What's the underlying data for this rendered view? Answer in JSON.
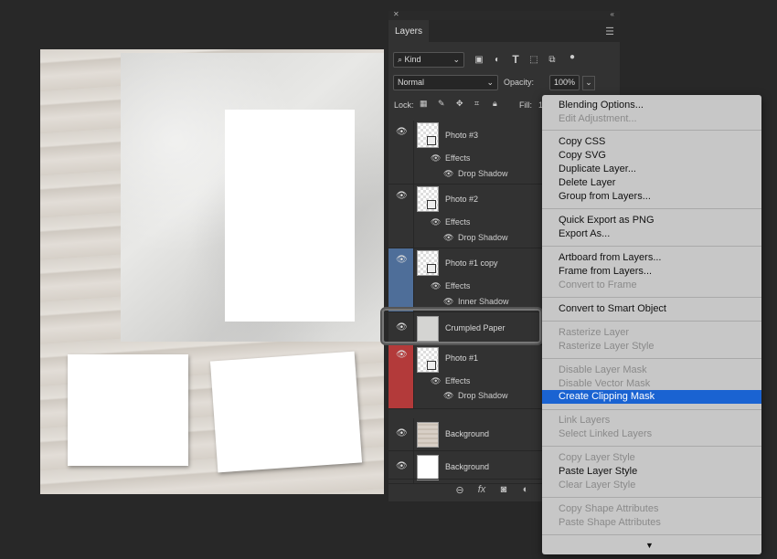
{
  "layers_panel": {
    "collapse_icon": "«",
    "close_icon": "✕",
    "tab": "Layers",
    "filter_kind": "Kind",
    "blend_mode": "Normal",
    "opacity_label": "Opacity:",
    "opacity_value": "100%",
    "lock_label": "Lock:",
    "fill_label": "Fill:",
    "fill_value": "1",
    "layers": [
      {
        "name": "Photo #3",
        "effects_label": "Effects",
        "effect": "Drop Shadow"
      },
      {
        "name": "Photo #2",
        "effects_label": "Effects",
        "effect": "Drop Shadow"
      },
      {
        "name": "Photo #1  copy",
        "effects_label": "Effects",
        "effect": "Inner Shadow"
      },
      {
        "name": "Crumpled Paper"
      },
      {
        "name": "Photo #1",
        "effects_label": "Effects",
        "effect": "Drop Shadow"
      },
      {
        "name": "Background"
      },
      {
        "name": "Background"
      }
    ],
    "bottom_icons": [
      "link-icon",
      "fx-icon",
      "mask-icon",
      "adjustment-icon"
    ],
    "colors": {
      "selected_row": "#4e6e99",
      "red_row": "#b33a3a",
      "panel_bg": "#323232"
    }
  },
  "context_menu": {
    "items": [
      {
        "label": "Blending Options...",
        "state": "enabled"
      },
      {
        "label": "Edit Adjustment...",
        "state": "disabled"
      },
      {
        "label": "Copy CSS",
        "state": "enabled"
      },
      {
        "label": "Copy SVG",
        "state": "enabled"
      },
      {
        "label": "Duplicate Layer...",
        "state": "enabled"
      },
      {
        "label": "Delete Layer",
        "state": "enabled"
      },
      {
        "label": "Group from Layers...",
        "state": "enabled"
      },
      {
        "label": "Quick Export as PNG",
        "state": "enabled"
      },
      {
        "label": "Export As...",
        "state": "enabled"
      },
      {
        "label": "Artboard from Layers...",
        "state": "enabled"
      },
      {
        "label": "Frame from Layers...",
        "state": "enabled"
      },
      {
        "label": "Convert to Frame",
        "state": "disabled"
      },
      {
        "label": "Convert to Smart Object",
        "state": "enabled"
      },
      {
        "label": "Rasterize Layer",
        "state": "disabled"
      },
      {
        "label": "Rasterize Layer Style",
        "state": "disabled"
      },
      {
        "label": "Disable Layer Mask",
        "state": "disabled"
      },
      {
        "label": "Disable Vector Mask",
        "state": "disabled"
      },
      {
        "label": "Create Clipping Mask",
        "state": "highlighted"
      },
      {
        "label": "Link Layers",
        "state": "disabled"
      },
      {
        "label": "Select Linked Layers",
        "state": "disabled"
      },
      {
        "label": "Copy Layer Style",
        "state": "disabled"
      },
      {
        "label": "Paste Layer Style",
        "state": "enabled"
      },
      {
        "label": "Clear Layer Style",
        "state": "disabled"
      },
      {
        "label": "Copy Shape Attributes",
        "state": "disabled"
      },
      {
        "label": "Paste Shape Attributes",
        "state": "disabled"
      }
    ],
    "scroll_arrow": "▼",
    "colors": {
      "highlight": "#1a63d2",
      "bg": "#c7c7c7"
    }
  }
}
